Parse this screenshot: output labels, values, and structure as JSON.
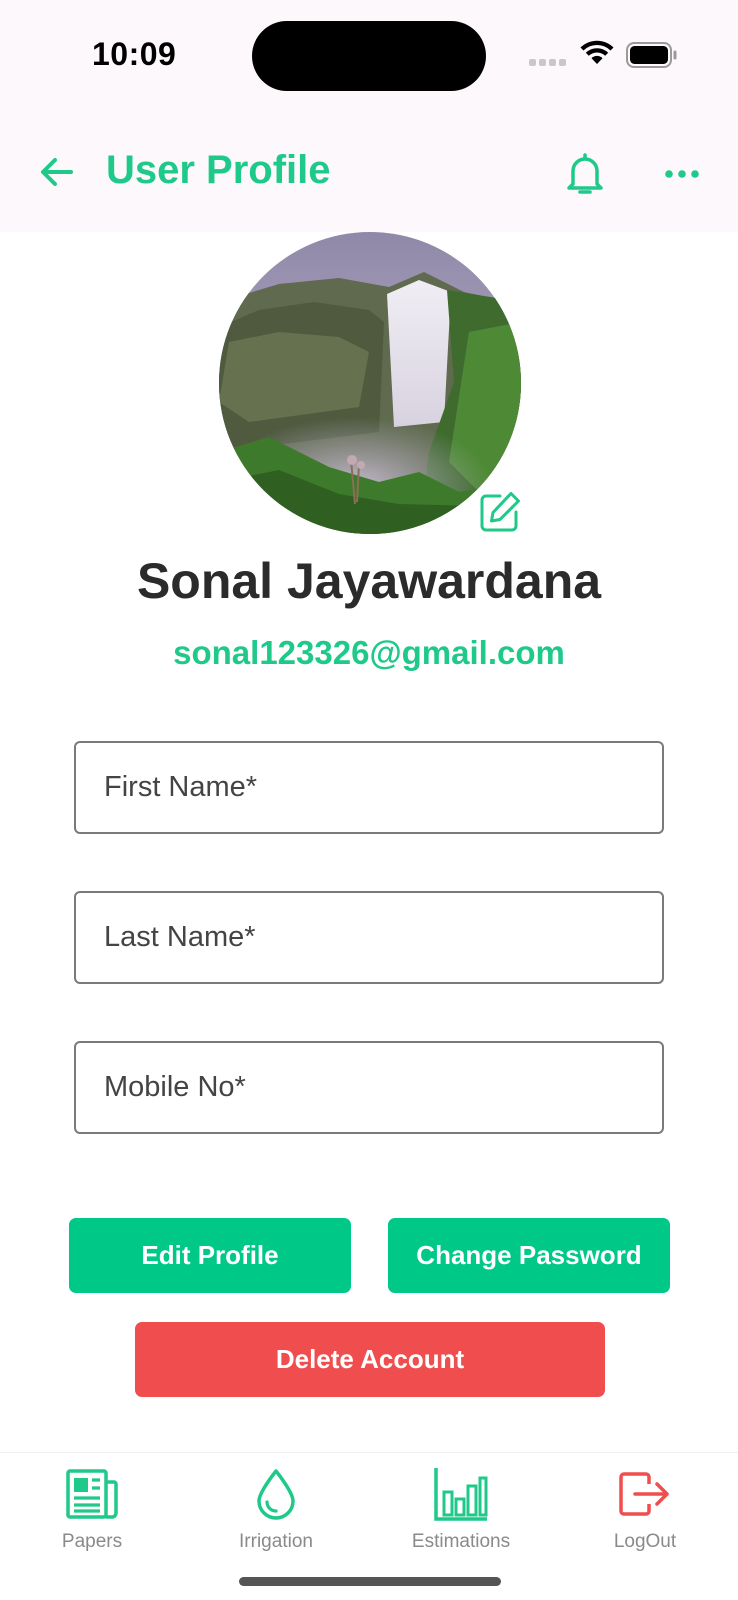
{
  "status_bar": {
    "time": "10:09",
    "icons": [
      "cellular-signal-icon",
      "wifi-icon",
      "battery-icon"
    ]
  },
  "header": {
    "title": "User Profile",
    "back_icon": "arrow-left-icon",
    "notification_icon": "bell-icon",
    "more_icon": "more-horizontal-icon"
  },
  "profile": {
    "name": "Sonal Jayawardana",
    "email": "sonal123326@gmail.com",
    "avatar_image": "waterfall landscape photo",
    "edit_icon": "edit-square-icon"
  },
  "form": {
    "first_name": {
      "value": "",
      "placeholder": "First Name*"
    },
    "last_name": {
      "value": "",
      "placeholder": "Last Name*"
    },
    "mobile_no": {
      "value": "",
      "placeholder": "Mobile No*"
    }
  },
  "actions": {
    "edit_profile": "Edit Profile",
    "change_password": "Change Password",
    "delete_account": "Delete Account"
  },
  "bottom_nav": {
    "items": [
      {
        "label": "Papers",
        "icon": "newspaper-icon",
        "color": "#1ec98a"
      },
      {
        "label": "Irrigation",
        "icon": "water-drop-icon",
        "color": "#1ec98a"
      },
      {
        "label": "Estimations",
        "icon": "bar-chart-icon",
        "color": "#1ec98a"
      },
      {
        "label": "LogOut",
        "icon": "logout-icon",
        "color": "#f04e4e"
      }
    ]
  },
  "colors": {
    "primary": "#1ec98a",
    "button_primary": "#00c887",
    "danger": "#f04e4e",
    "app_bar_bg": "#fdf8fc",
    "text_dark": "#2b2b2b",
    "nav_label": "#8a8a8a"
  }
}
